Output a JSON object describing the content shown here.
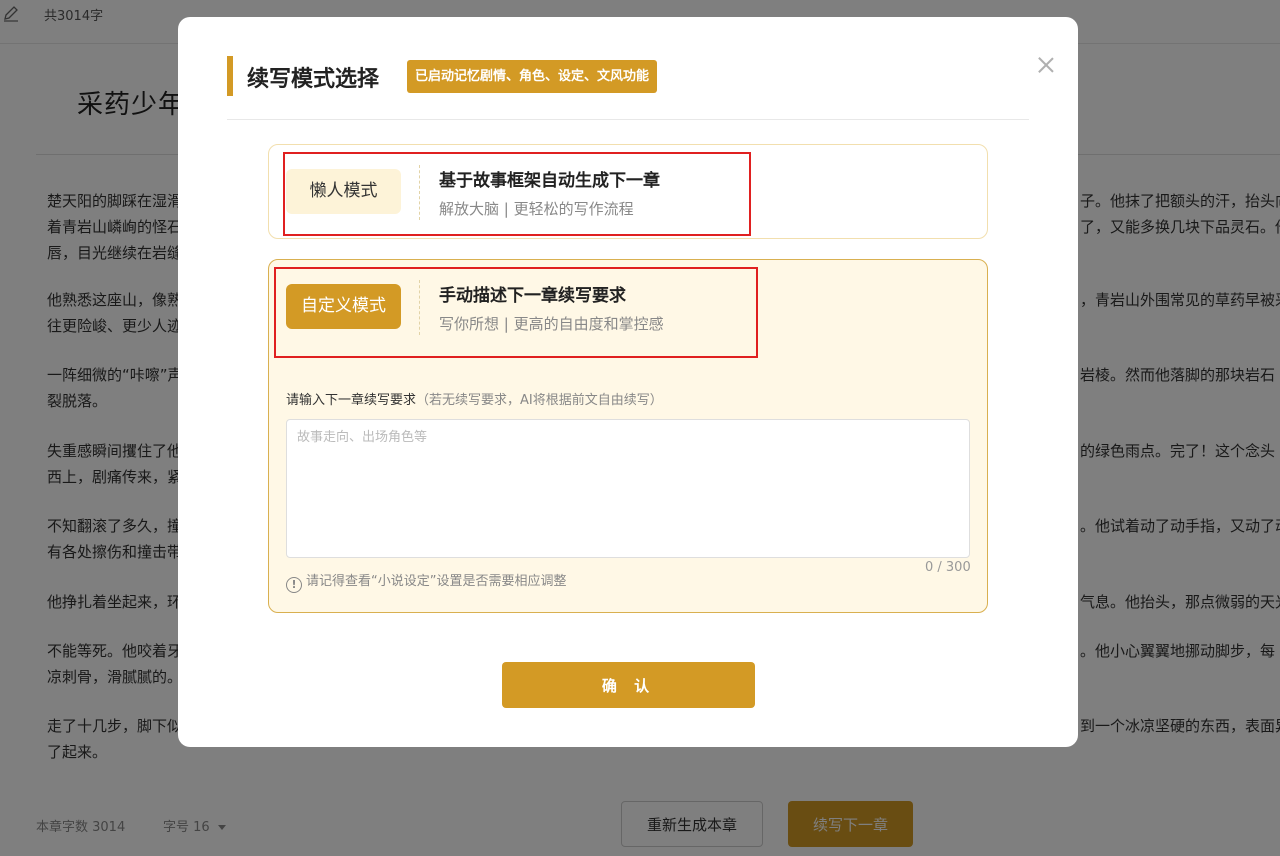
{
  "editor": {
    "word_count_top": "共3014字",
    "doc_title": "采药少年",
    "paragraphs_left": [
      {
        "l1": "楚天阳的脚踩在湿滑",
        "l2": "着青岩山嶙峋的怪石",
        "l3": "唇，目光继续在岩缝"
      },
      {
        "l1": "他熟悉这座山，像熟",
        "l2": "往更险峻、更少人迹"
      },
      {
        "l1": "一阵细微的“咔嚓”声",
        "l2": "裂脱落。"
      },
      {
        "l1": "失重感瞬间攫住了他",
        "l2": "西上，剧痛传来，紧"
      },
      {
        "l1": "不知翻滚了多久，撞",
        "l2": "有各处擦伤和撞击带"
      },
      {
        "l1": "他挣扎着坐起来，环"
      },
      {
        "l1": "不能等死。他咬着牙",
        "l2": "凉刺骨，滑腻腻的。"
      },
      {
        "l1": "走了十几步，脚下似",
        "l2": "了起来。"
      }
    ],
    "paragraphs_right": [
      {
        "l1": "子。他抹了把额头的汗，抬头向",
        "l2": "了，又能多换几块下品灵石。他"
      },
      {
        "l1": "，青岩山外围常见的草药早被采"
      },
      {
        "l1": "岩棱。然而他落脚的那块岩石"
      },
      {
        "l1": "的绿色雨点。完了！这个念头"
      },
      {
        "l1": "。他试着动了动手指，又动了动"
      },
      {
        "l1": "气息。他抬头，那点微弱的天光"
      },
      {
        "l1": "。他小心翼翼地挪动脚步，每"
      },
      {
        "l1": "到一个冰凉坚硬的东西，表面异"
      }
    ],
    "chapter_word_count": "本章字数 3014",
    "font_size_label": "字号 16",
    "regenerate_label": "重新生成本章",
    "continue_label": "续写下一章"
  },
  "modal": {
    "title": "续写模式选择",
    "memory_badge": "已启动记忆剧情、角色、设定、文风功能",
    "lazy_mode": {
      "button_label": "懒人模式",
      "heading": "基于故事框架自动生成下一章",
      "subtitle": "解放大脑 | 更轻松的写作流程"
    },
    "custom_mode": {
      "button_label": "自定义模式",
      "heading": "手动描述下一章续写要求",
      "subtitle": "写你所想 | 更高的自由度和掌控感",
      "input_label": "请输入下一章续写要求",
      "input_hint": "（若无续写要求，AI将根据前文自由续写）",
      "placeholder": "故事走向、出场角色等",
      "counter": "0 / 300",
      "tip": "请记得查看“小说设定”设置是否需要相应调整"
    },
    "confirm_label": "确 认"
  },
  "colors": {
    "accent": "#d39a25",
    "highlight_annotation": "#e02020",
    "custom_card_bg": "#fff8e6"
  }
}
